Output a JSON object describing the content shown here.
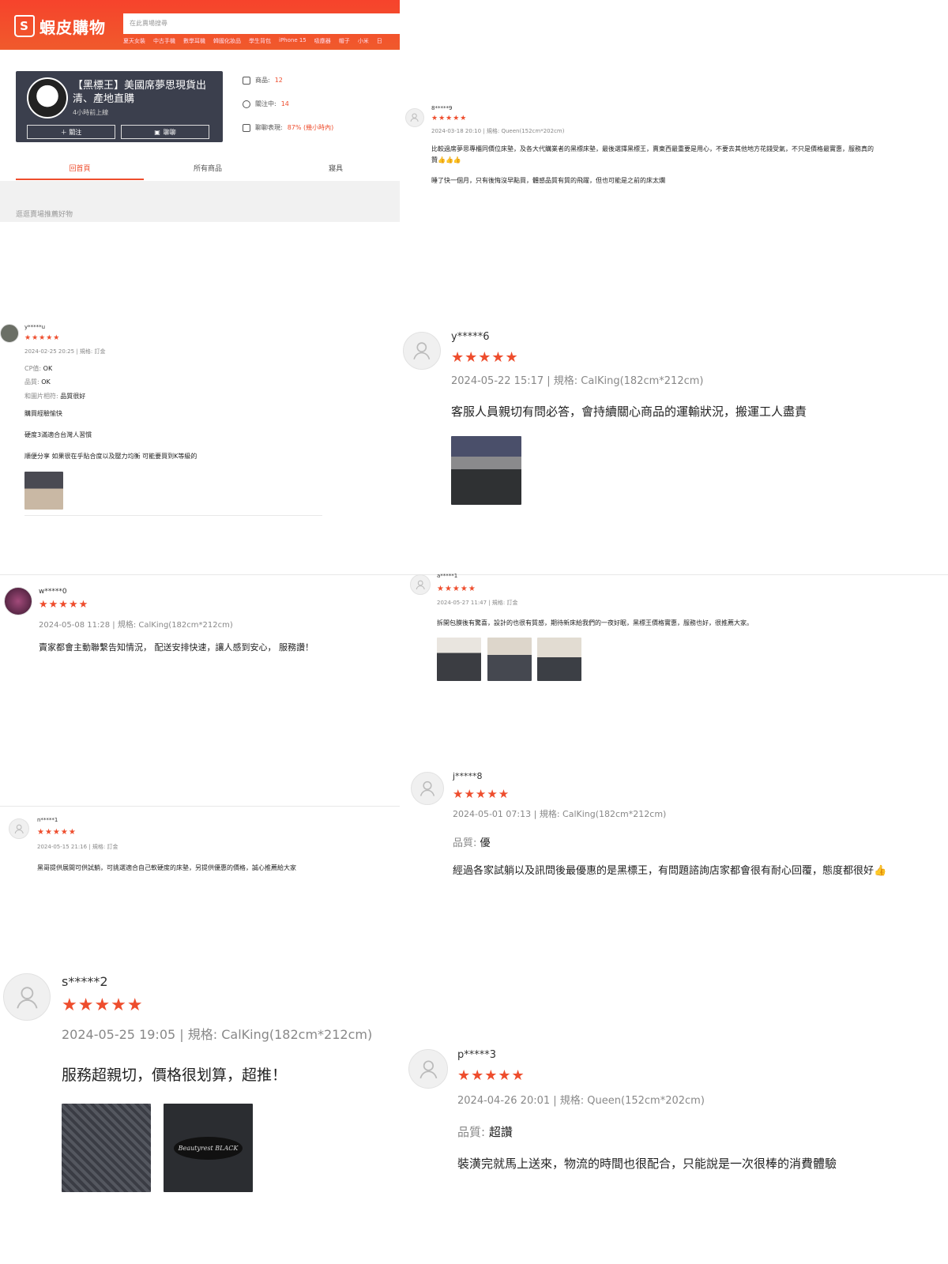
{
  "header": {
    "logo_text": "蝦皮購物",
    "logo_icon": "shopping-bag-icon",
    "search_placeholder": "在此賣場搜尋",
    "hot_keywords": [
      "夏天女裝",
      "中古手機",
      "數學耳機",
      "韓國化妝品",
      "學生背包",
      "iPhone 15",
      "吸塵器",
      "帽子",
      "小米",
      "日"
    ]
  },
  "shop": {
    "name": "【黑標王】美國席夢思現貨出清、產地直購",
    "online_status": "4小時前上線",
    "follow_label": "＋ 關注",
    "chat_label": "聊聊",
    "stats": [
      {
        "icon": "store-icon",
        "label": "商品:",
        "value": "12"
      },
      {
        "icon": "person-icon",
        "label": "關注中:",
        "value": "14"
      },
      {
        "icon": "chat-icon",
        "label": "聊聊表現:",
        "value": "87% (幾小時內)"
      }
    ],
    "tabs": [
      "回首頁",
      "所有商品",
      "寢具"
    ],
    "recommend_title": "逛逛賣場推薦好物"
  },
  "accent_color": "#ee4d2d",
  "reviews": [
    {
      "user": "8*****9",
      "stars": "★★★★★",
      "meta": "2024-03-18 20:10 | 規格: Queen(152cm*202cm)",
      "lines": [
        "比較過席夢思專櫃同價位床墊，及各大代購業者的黑標床墊，最後選擇黑標王，賣東西最重要是用心，不要去其他地方花錢受氣，不只是價格最實惠，服務真的",
        "贊👍👍👍",
        "睡了快一個月，只有後悔沒早點買，體感品質有質的飛躍，但也可能是之前的床太爛"
      ]
    },
    {
      "user": "y*****u",
      "stars": "★★★★★",
      "meta": "2024-02-25 20:25 | 規格: 訂金",
      "lines": [
        {
          "k": "CP值:",
          "v": "OK"
        },
        {
          "k": "品質:",
          "v": "OK"
        },
        {
          "k": "和圖片相符:",
          "v": "品質很好"
        },
        "購買經驗愉快",
        "硬度3滿適合台灣人習慣",
        "順便分享 如果很在乎貼合度以及壓力均衡 可能要買到K等級的"
      ]
    },
    {
      "user": "y*****6",
      "stars": "★★★★★",
      "meta": "2024-05-22 15:17 | 規格: CalKing(182cm*212cm)",
      "lines": [
        "客服人員親切有問必答，會持續關心商品的運輸狀況，搬運工人盡責"
      ]
    },
    {
      "user": "w*****0",
      "stars": "★★★★★",
      "meta": "2024-05-08 11:28 | 規格: CalKing(182cm*212cm)",
      "lines": [
        "賣家都會主動聯繫告知情況， 配送安排快速，讓人感到安心， 服務讚！"
      ]
    },
    {
      "user": "a*****1",
      "stars": "★★★★★",
      "meta": "2024-05-27 11:47 | 規格: 訂金",
      "lines": [
        "拆開包膜後有驚喜，設計的也很有質感，期待新床給我們的一夜好眠，黑標王價格實惠，服務也好，很推薦大家。"
      ]
    },
    {
      "user": "j*****8",
      "stars": "★★★★★",
      "meta": "2024-05-01 07:13 | 規格: CalKing(182cm*212cm)",
      "lines": [
        {
          "k": "品質:",
          "v": "優"
        },
        "經過各家試躺以及訊問後最優惠的是黑標王，有問題諮詢店家都會很有耐心回覆，態度都很好👍"
      ]
    },
    {
      "user": "n*****1",
      "stars": "★★★★★",
      "meta": "2024-05-15 21:16 | 規格: 訂金",
      "lines": [
        "黑哥提供展間可供試躺，可挑選適合自己軟硬度的床墊，另提供優惠的價格，誠心推薦給大家"
      ]
    },
    {
      "user": "s*****2",
      "stars": "★★★★★",
      "meta": "2024-05-25 19:05 | 規格: CalKing(182cm*212cm)",
      "lines": [
        "服務超親切，價格很划算，超推！"
      ]
    },
    {
      "user": "p*****3",
      "stars": "★★★★★",
      "meta": "2024-04-26 20:01 | 規格: Queen(152cm*202cm)",
      "lines": [
        {
          "k": "品質:",
          "v": "超讚"
        },
        "裝潢完就馬上送來，物流的時間也很配合，只能說是一次很棒的消費體驗"
      ]
    }
  ],
  "thumb_brand_text": "Beautyrest BLACK"
}
